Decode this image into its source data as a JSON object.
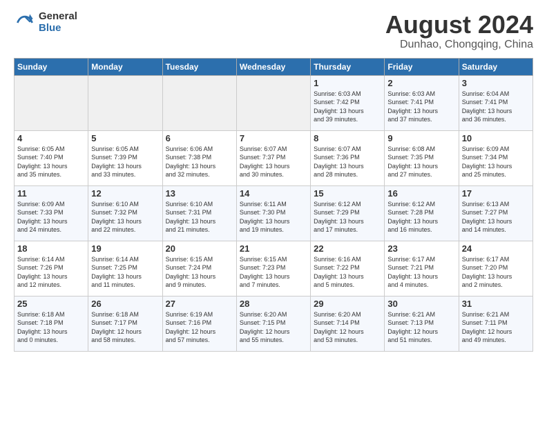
{
  "logo": {
    "general": "General",
    "blue": "Blue"
  },
  "title": "August 2024",
  "subtitle": "Dunhao, Chongqing, China",
  "days_of_week": [
    "Sunday",
    "Monday",
    "Tuesday",
    "Wednesday",
    "Thursday",
    "Friday",
    "Saturday"
  ],
  "weeks": [
    [
      {
        "day": "",
        "info": ""
      },
      {
        "day": "",
        "info": ""
      },
      {
        "day": "",
        "info": ""
      },
      {
        "day": "",
        "info": ""
      },
      {
        "day": "1",
        "info": "Sunrise: 6:03 AM\nSunset: 7:42 PM\nDaylight: 13 hours\nand 39 minutes."
      },
      {
        "day": "2",
        "info": "Sunrise: 6:03 AM\nSunset: 7:41 PM\nDaylight: 13 hours\nand 37 minutes."
      },
      {
        "day": "3",
        "info": "Sunrise: 6:04 AM\nSunset: 7:41 PM\nDaylight: 13 hours\nand 36 minutes."
      }
    ],
    [
      {
        "day": "4",
        "info": "Sunrise: 6:05 AM\nSunset: 7:40 PM\nDaylight: 13 hours\nand 35 minutes."
      },
      {
        "day": "5",
        "info": "Sunrise: 6:05 AM\nSunset: 7:39 PM\nDaylight: 13 hours\nand 33 minutes."
      },
      {
        "day": "6",
        "info": "Sunrise: 6:06 AM\nSunset: 7:38 PM\nDaylight: 13 hours\nand 32 minutes."
      },
      {
        "day": "7",
        "info": "Sunrise: 6:07 AM\nSunset: 7:37 PM\nDaylight: 13 hours\nand 30 minutes."
      },
      {
        "day": "8",
        "info": "Sunrise: 6:07 AM\nSunset: 7:36 PM\nDaylight: 13 hours\nand 28 minutes."
      },
      {
        "day": "9",
        "info": "Sunrise: 6:08 AM\nSunset: 7:35 PM\nDaylight: 13 hours\nand 27 minutes."
      },
      {
        "day": "10",
        "info": "Sunrise: 6:09 AM\nSunset: 7:34 PM\nDaylight: 13 hours\nand 25 minutes."
      }
    ],
    [
      {
        "day": "11",
        "info": "Sunrise: 6:09 AM\nSunset: 7:33 PM\nDaylight: 13 hours\nand 24 minutes."
      },
      {
        "day": "12",
        "info": "Sunrise: 6:10 AM\nSunset: 7:32 PM\nDaylight: 13 hours\nand 22 minutes."
      },
      {
        "day": "13",
        "info": "Sunrise: 6:10 AM\nSunset: 7:31 PM\nDaylight: 13 hours\nand 21 minutes."
      },
      {
        "day": "14",
        "info": "Sunrise: 6:11 AM\nSunset: 7:30 PM\nDaylight: 13 hours\nand 19 minutes."
      },
      {
        "day": "15",
        "info": "Sunrise: 6:12 AM\nSunset: 7:29 PM\nDaylight: 13 hours\nand 17 minutes."
      },
      {
        "day": "16",
        "info": "Sunrise: 6:12 AM\nSunset: 7:28 PM\nDaylight: 13 hours\nand 16 minutes."
      },
      {
        "day": "17",
        "info": "Sunrise: 6:13 AM\nSunset: 7:27 PM\nDaylight: 13 hours\nand 14 minutes."
      }
    ],
    [
      {
        "day": "18",
        "info": "Sunrise: 6:14 AM\nSunset: 7:26 PM\nDaylight: 13 hours\nand 12 minutes."
      },
      {
        "day": "19",
        "info": "Sunrise: 6:14 AM\nSunset: 7:25 PM\nDaylight: 13 hours\nand 11 minutes."
      },
      {
        "day": "20",
        "info": "Sunrise: 6:15 AM\nSunset: 7:24 PM\nDaylight: 13 hours\nand 9 minutes."
      },
      {
        "day": "21",
        "info": "Sunrise: 6:15 AM\nSunset: 7:23 PM\nDaylight: 13 hours\nand 7 minutes."
      },
      {
        "day": "22",
        "info": "Sunrise: 6:16 AM\nSunset: 7:22 PM\nDaylight: 13 hours\nand 5 minutes."
      },
      {
        "day": "23",
        "info": "Sunrise: 6:17 AM\nSunset: 7:21 PM\nDaylight: 13 hours\nand 4 minutes."
      },
      {
        "day": "24",
        "info": "Sunrise: 6:17 AM\nSunset: 7:20 PM\nDaylight: 13 hours\nand 2 minutes."
      }
    ],
    [
      {
        "day": "25",
        "info": "Sunrise: 6:18 AM\nSunset: 7:18 PM\nDaylight: 13 hours\nand 0 minutes."
      },
      {
        "day": "26",
        "info": "Sunrise: 6:18 AM\nSunset: 7:17 PM\nDaylight: 12 hours\nand 58 minutes."
      },
      {
        "day": "27",
        "info": "Sunrise: 6:19 AM\nSunset: 7:16 PM\nDaylight: 12 hours\nand 57 minutes."
      },
      {
        "day": "28",
        "info": "Sunrise: 6:20 AM\nSunset: 7:15 PM\nDaylight: 12 hours\nand 55 minutes."
      },
      {
        "day": "29",
        "info": "Sunrise: 6:20 AM\nSunset: 7:14 PM\nDaylight: 12 hours\nand 53 minutes."
      },
      {
        "day": "30",
        "info": "Sunrise: 6:21 AM\nSunset: 7:13 PM\nDaylight: 12 hours\nand 51 minutes."
      },
      {
        "day": "31",
        "info": "Sunrise: 6:21 AM\nSunset: 7:11 PM\nDaylight: 12 hours\nand 49 minutes."
      }
    ]
  ]
}
